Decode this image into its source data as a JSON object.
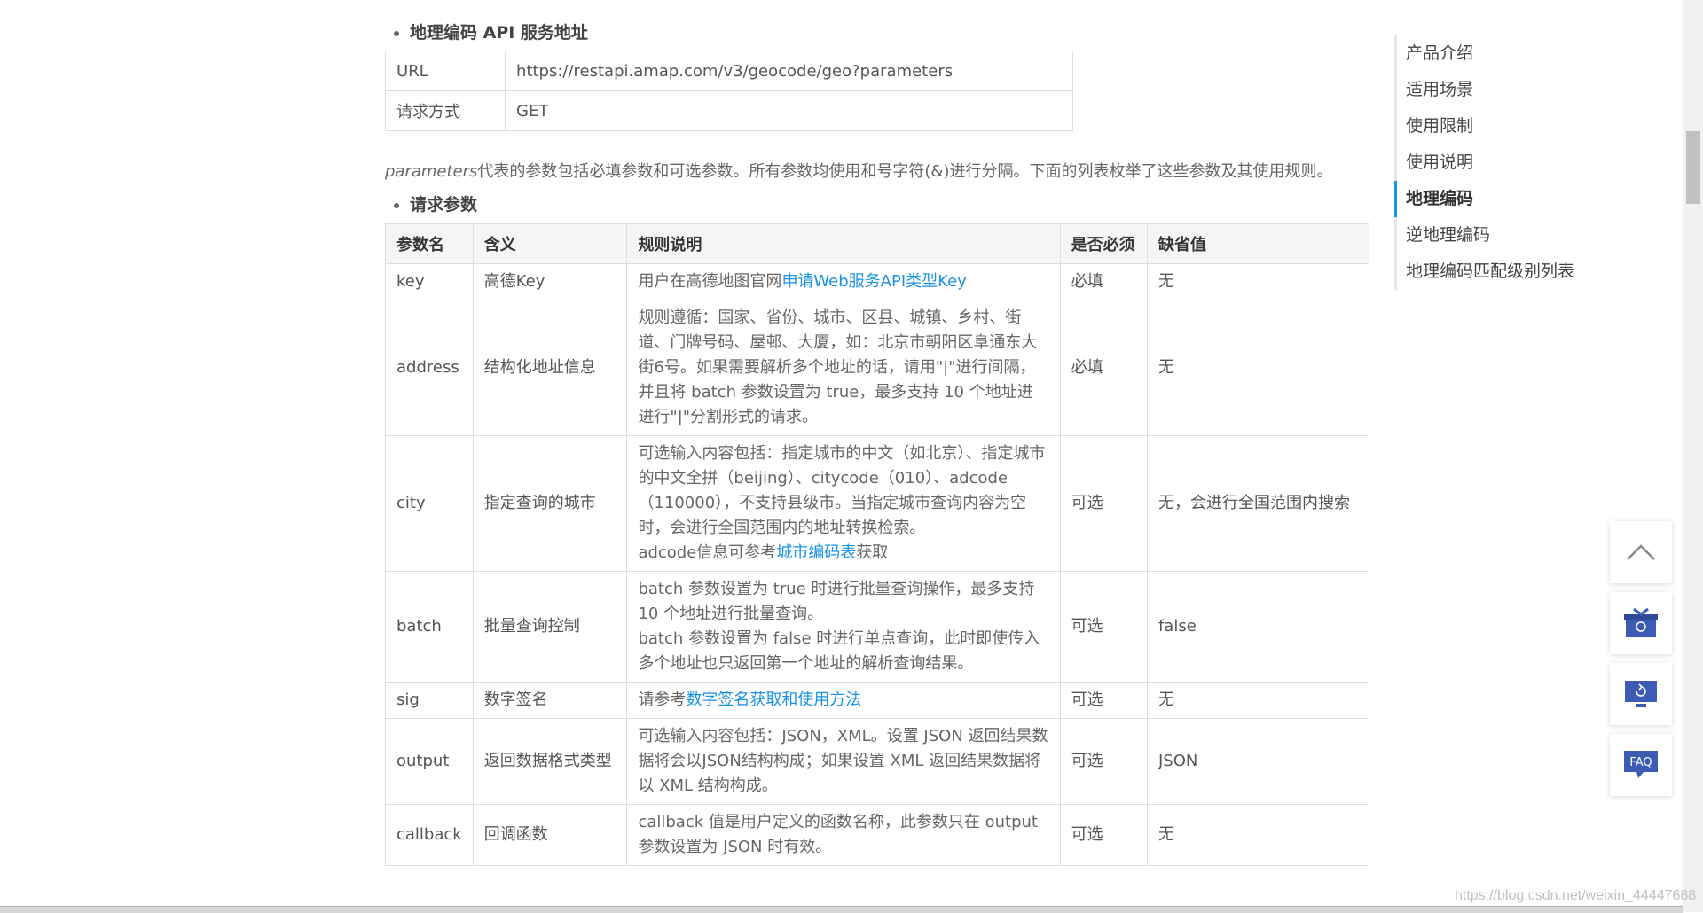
{
  "section1": {
    "title": "地理编码 API 服务地址"
  },
  "url_table": {
    "rows": [
      {
        "key": "URL",
        "value": "https://restapi.amap.com/v3/geocode/geo?parameters"
      },
      {
        "key": "请求方式",
        "value": "GET"
      }
    ]
  },
  "param_desc": {
    "italic": "parameters",
    "rest": "代表的参数包括必填参数和可选参数。所有参数均使用和号字符(&)进行分隔。下面的列表枚举了这些参数及其使用规则。"
  },
  "section2": {
    "title": "请求参数"
  },
  "param_table": {
    "headers": [
      "参数名",
      "含义",
      "规则说明",
      "是否必须",
      "缺省值"
    ],
    "rows": {
      "key": {
        "name": "key",
        "meaning": "高德Key",
        "rule_prefix": "用户在高德地图官网",
        "rule_link": "申请Web服务API类型Key",
        "required": "必填",
        "default": "无"
      },
      "address": {
        "name": "address",
        "meaning": "结构化地址信息",
        "rule": "规则遵循：国家、省份、城市、区县、城镇、乡村、街道、门牌号码、屋邨、大厦，如：北京市朝阳区阜通东大街6号。如果需要解析多个地址的话，请用\"|\"进行间隔，并且将 batch 参数设置为 true，最多支持 10 个地址进进行\"|\"分割形式的请求。",
        "required": "必填",
        "default": "无"
      },
      "city": {
        "name": "city",
        "meaning": "指定查询的城市",
        "rule_line1": "可选输入内容包括：指定城市的中文（如北京）、指定城市的中文全拼（beijing）、citycode（010）、adcode（110000），不支持县级市。当指定城市查询内容为空时，会进行全国范围内的地址转换检索。",
        "rule_line2_prefix": "adcode信息可参考",
        "rule_line2_link": "城市编码表",
        "rule_line2_suffix": "获取",
        "required": "可选",
        "default": "无，会进行全国范围内搜索"
      },
      "batch": {
        "name": "batch",
        "meaning": "批量查询控制",
        "rule_line1": "batch 参数设置为 true 时进行批量查询操作，最多支持 10 个地址进行批量查询。",
        "rule_line2": "batch 参数设置为 false 时进行单点查询，此时即使传入多个地址也只返回第一个地址的解析查询结果。",
        "required": "可选",
        "default": "false"
      },
      "sig": {
        "name": "sig",
        "meaning": "数字签名",
        "rule_prefix": "请参考",
        "rule_link": "数字签名获取和使用方法",
        "required": "可选",
        "default": "无"
      },
      "output": {
        "name": "output",
        "meaning": "返回数据格式类型",
        "rule": "可选输入内容包括：JSON，XML。设置 JSON 返回结果数据将会以JSON结构构成；如果设置 XML 返回结果数据将以 XML 结构构成。",
        "required": "可选",
        "default": "JSON"
      },
      "callback": {
        "name": "callback",
        "meaning": "回调函数",
        "rule": "callback 值是用户定义的函数名称，此参数只在 output 参数设置为 JSON 时有效。",
        "required": "可选",
        "default": "无"
      }
    }
  },
  "toc": {
    "items": [
      "产品介绍",
      "适用场景",
      "使用限制",
      "使用说明",
      "地理编码",
      "逆地理编码",
      "地理编码匹配级别列表"
    ],
    "active_index": 4
  },
  "float_buttons": {
    "top_icon": "chevron-up-icon",
    "gift_icon": "gift-icon",
    "feedback_icon": "monitor-icon",
    "faq_label": "FAQ"
  },
  "watermark": "https://blog.csdn.net/weixin_44447688",
  "colors": {
    "link": "#1a93e6",
    "icon": "#3b5bb5",
    "active_toc": "#1a93e6"
  }
}
